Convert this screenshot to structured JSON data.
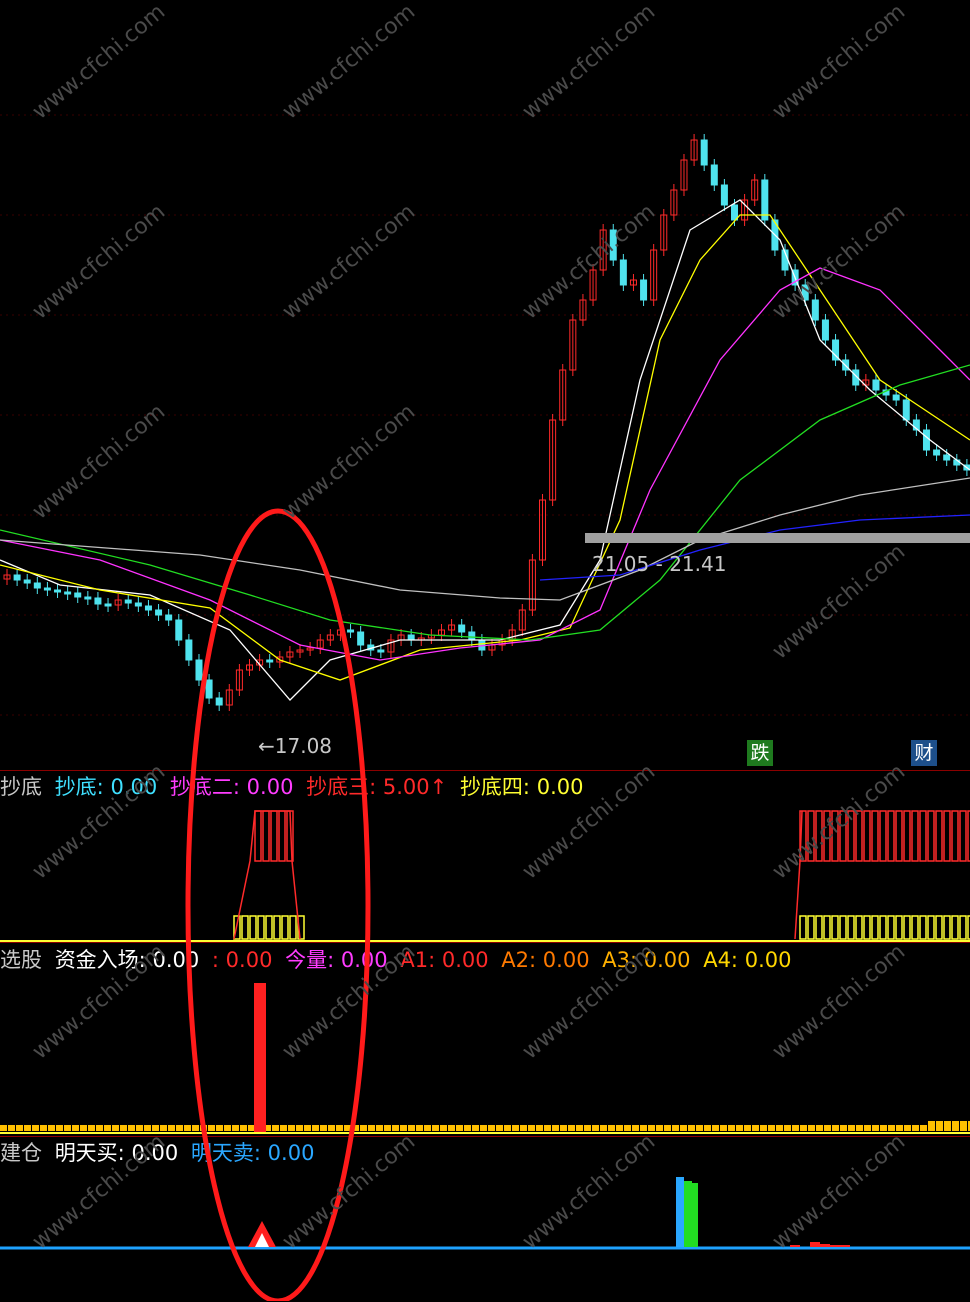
{
  "main_chart": {
    "low_label": "←17.08",
    "range_label": "21.05 - 21.41",
    "tags": [
      {
        "text": "跌",
        "color": "#1e7a1e"
      },
      {
        "text": "财",
        "color": "#1d4f8a"
      }
    ]
  },
  "panel_chaodi": {
    "name": "抄底",
    "items": [
      {
        "label": "抄底:",
        "value": "0.00",
        "color": "#3fe0ff"
      },
      {
        "label": "抄底二:",
        "value": "0.00",
        "color": "#ff3cff"
      },
      {
        "label": "抄底三:",
        "value": "5.00↑",
        "color": "#ff2a2a"
      },
      {
        "label": "抄底四:",
        "value": "0.00",
        "color": "#ffff33"
      }
    ]
  },
  "panel_xuangu": {
    "name": "选股",
    "items": [
      {
        "label": "资金入场:",
        "value": "0.00",
        "color": "#ffffff"
      },
      {
        "label": ":",
        "value": "0.00",
        "color": "#ff2a2a"
      },
      {
        "label": "今量:",
        "value": "0.00",
        "color": "#ff3cff"
      },
      {
        "label": "A1:",
        "value": "0.00",
        "color": "#ff2a2a"
      },
      {
        "label": "A2:",
        "value": "0.00",
        "color": "#ff7a00"
      },
      {
        "label": "A3:",
        "value": "0.00",
        "color": "#ffb000"
      },
      {
        "label": "A4:",
        "value": "0.00",
        "color": "#ffd700"
      }
    ]
  },
  "panel_jiancang": {
    "name": "建仓",
    "items": [
      {
        "label": "明天买:",
        "value": "0.00",
        "color": "#ffffff"
      },
      {
        "label": "明天卖:",
        "value": "0.00",
        "color": "#2aa7ff"
      }
    ]
  },
  "watermark": "www.cfchi.com",
  "colors": {
    "up": "#ff2a2a",
    "down": "#4fe3ee",
    "ma5": "#ffffff",
    "ma10": "#ffff00",
    "ma20": "#ff33ff",
    "ma60": "#22dd22",
    "ma120": "#c0c0c0",
    "ma250": "#2222ff",
    "highlight": "#ff1a1a"
  }
}
